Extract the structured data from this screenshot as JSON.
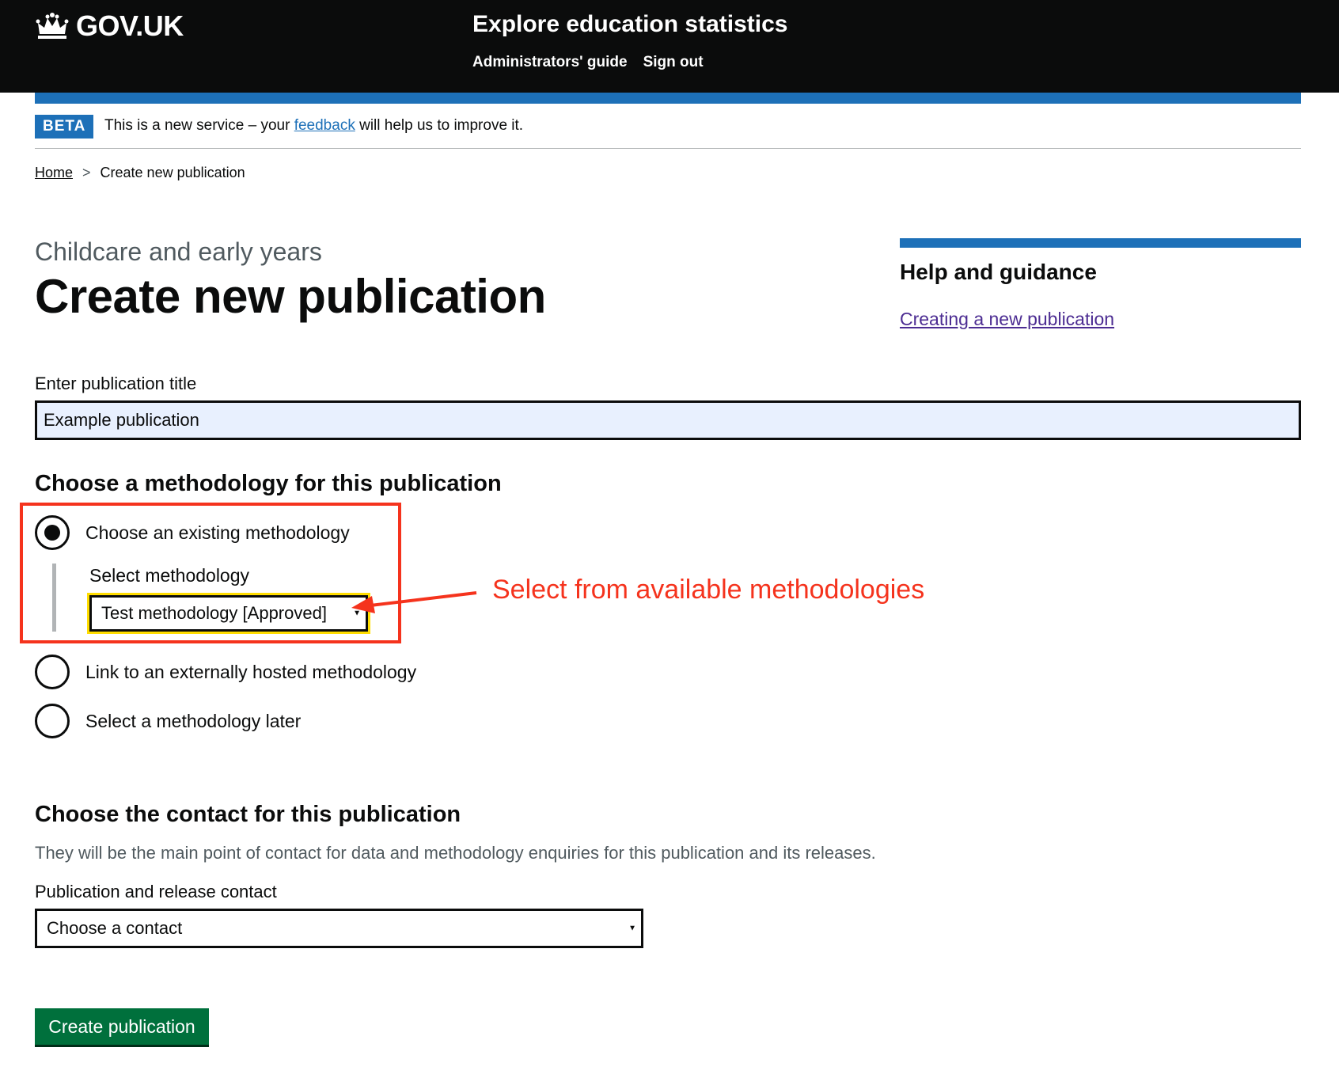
{
  "header": {
    "logo_text": "GOV.UK",
    "service_name": "Explore education statistics",
    "nav": [
      "Administrators' guide",
      "Sign out"
    ]
  },
  "phase_banner": {
    "tag": "BETA",
    "text_before": "This is a new service – your ",
    "link": "feedback",
    "text_after": " will help us to improve it."
  },
  "breadcrumb": {
    "home": "Home",
    "current": "Create new publication",
    "separator": ">"
  },
  "page": {
    "caption": "Childcare and early years",
    "title": "Create new publication"
  },
  "sidebar": {
    "title": "Help and guidance",
    "link": "Creating a new publication"
  },
  "form": {
    "title_label": "Enter publication title",
    "title_value": "Example publication",
    "methodology_heading": "Choose a methodology for this publication",
    "methodology_options": [
      {
        "label": "Choose an existing methodology",
        "checked": true
      },
      {
        "label": "Link to an externally hosted methodology",
        "checked": false
      },
      {
        "label": "Select a methodology later",
        "checked": false
      }
    ],
    "select_methodology_label": "Select methodology",
    "select_methodology_value": "Test methodology [Approved]",
    "contact_heading": "Choose the contact for this publication",
    "contact_hint": "They will be the main point of contact for data and methodology enquiries for this publication and its releases.",
    "contact_label": "Publication and release contact",
    "contact_value": "Choose a contact",
    "submit": "Create publication"
  },
  "annotation": {
    "text": "Select from available methodologies",
    "color": "#f5331d"
  },
  "colors": {
    "header_bg": "#0b0c0c",
    "brand_blue": "#1d70b8",
    "button_green": "#00703c",
    "focus_yellow": "#ffdd00"
  }
}
